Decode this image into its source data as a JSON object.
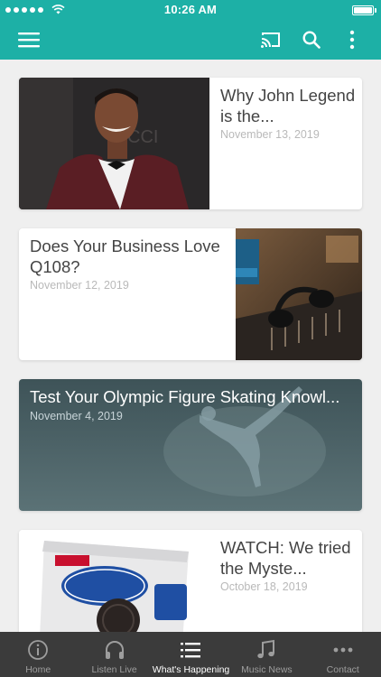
{
  "status_bar": {
    "time": "10:26 AM",
    "signal_dots": 5
  },
  "app_bar": {
    "menu_icon": "hamburger-menu-icon",
    "cast_icon": "cast-icon",
    "search_icon": "search-icon",
    "more_icon": "more-vertical-icon",
    "color": "#1db0a6"
  },
  "articles": [
    {
      "title": "Why John Legend is the...",
      "date": "November 13, 2019"
    },
    {
      "title": "Does Your Business Love Q108?",
      "date": "November 12, 2019"
    },
    {
      "title": "Test Your Olympic Figure Skating Knowl...",
      "date": "November 4, 2019"
    },
    {
      "title": "WATCH: We tried the Myste...",
      "date": "October 18, 2019"
    }
  ],
  "tabs": [
    {
      "label": "Home",
      "icon": "info-icon",
      "active": false
    },
    {
      "label": "Listen Live",
      "icon": "headphones-icon",
      "active": false
    },
    {
      "label": "What's Happening",
      "icon": "list-icon",
      "active": true
    },
    {
      "label": "Music News",
      "icon": "music-note-icon",
      "active": false
    },
    {
      "label": "Contact",
      "icon": "more-horizontal-icon",
      "active": false
    }
  ]
}
